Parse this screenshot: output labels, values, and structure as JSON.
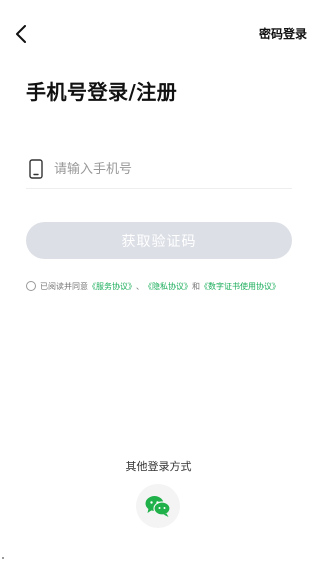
{
  "header": {
    "back_icon": "chevron-left-icon",
    "password_login_label": "密码登录"
  },
  "main": {
    "title": "手机号登录/注册",
    "phone_input": {
      "icon": "mobile-phone-icon",
      "placeholder": "请输入手机号",
      "value": ""
    },
    "get_code_label": "获取验证码",
    "agreement": {
      "prefix": "已阅读并同意",
      "service_link": "《服务协议》",
      "sep1": "、",
      "privacy_link": "《隐私协议》",
      "and": "和",
      "cert_link": "《数字证书使用协议》"
    }
  },
  "other_login": {
    "title": "其他登录方式",
    "wechat_icon": "wechat-icon"
  },
  "colors": {
    "accent_link": "#1aad5a",
    "button_disabled": "#dcdfe6",
    "wechat_green": "#21b14b"
  }
}
